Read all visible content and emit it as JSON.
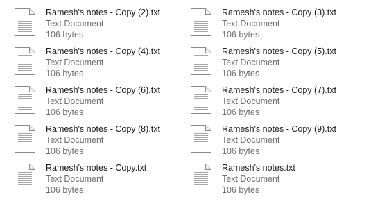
{
  "files": [
    {
      "name": "Ramesh's notes - Copy (2).txt",
      "type": "Text Document",
      "size": "106 bytes"
    },
    {
      "name": "Ramesh's notes - Copy (3).txt",
      "type": "Text Document",
      "size": "106 bytes"
    },
    {
      "name": "Ramesh's notes - Copy (4).txt",
      "type": "Text Document",
      "size": "106 bytes"
    },
    {
      "name": "Ramesh's notes - Copy (5).txt",
      "type": "Text Document",
      "size": "106 bytes"
    },
    {
      "name": "Ramesh's notes - Copy (6).txt",
      "type": "Text Document",
      "size": "106 bytes"
    },
    {
      "name": "Ramesh's notes - Copy (7).txt",
      "type": "Text Document",
      "size": "106 bytes"
    },
    {
      "name": "Ramesh's notes - Copy (8).txt",
      "type": "Text Document",
      "size": "106 bytes"
    },
    {
      "name": "Ramesh's notes - Copy (9).txt",
      "type": "Text Document",
      "size": "106 bytes"
    },
    {
      "name": "Ramesh's notes - Copy.txt",
      "type": "Text Document",
      "size": "106 bytes"
    },
    {
      "name": "Ramesh's notes.txt",
      "type": "Text Document",
      "size": "106 bytes"
    }
  ],
  "icon": "text-document-icon"
}
